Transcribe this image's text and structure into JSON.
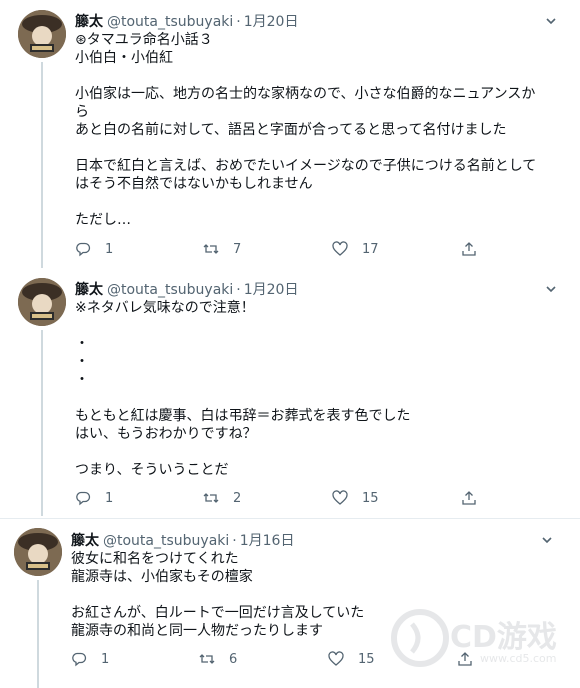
{
  "tweets": [
    {
      "name": "籐太",
      "handle": "@touta_tsubuyaki",
      "date": "1月20日",
      "lines": [
        "⊛タマユラ命名小話３",
        "小伯白・小伯紅",
        "",
        "小伯家は一応、地方の名士的な家柄なので、小さな伯爵的なニュアンスか",
        "ら",
        "あと白の名前に対して、語呂と字面が合ってると思って名付けました",
        "",
        "日本で紅白と言えば、おめでたいイメージなので子供につける名前として",
        "はそう不自然ではないかもしれません",
        "",
        "ただし…"
      ],
      "replies": "1",
      "retweets": "7",
      "likes": "17"
    },
    {
      "name": "籐太",
      "handle": "@touta_tsubuyaki",
      "date": "1月20日",
      "lines": [
        "※ネタバレ気味なので注意！",
        "",
        "・",
        "・",
        "・",
        "",
        "もともと紅は慶事、白は弔辞＝お葬式を表す色でした",
        "はい、もうおわかりですね？",
        "",
        "つまり、そういうことだ"
      ],
      "replies": "1",
      "retweets": "2",
      "likes": "15"
    },
    {
      "name": "籐太",
      "handle": "@touta_tsubuyaki",
      "date": "1月16日",
      "lines": [
        "彼女に和名をつけてくれた",
        "龍源寺は、小伯家もその檀家",
        "",
        "お紅さんが、白ルートで一回だけ言及していた",
        "龍源寺の和尚と同一人物だったりします"
      ],
      "replies": "1",
      "retweets": "6",
      "likes": "15"
    }
  ],
  "icons": {
    "reply": "reply-icon",
    "retweet": "retweet-icon",
    "like": "heart-icon",
    "share": "share-icon",
    "more": "chevron-down-icon"
  },
  "watermark": {
    "text": "CD游戏",
    "url": "www.cd5.com"
  },
  "colors": {
    "text": "#0f1419",
    "muted": "#536471",
    "thread_line": "#cfd9de",
    "separator": "#e6ecf0"
  }
}
